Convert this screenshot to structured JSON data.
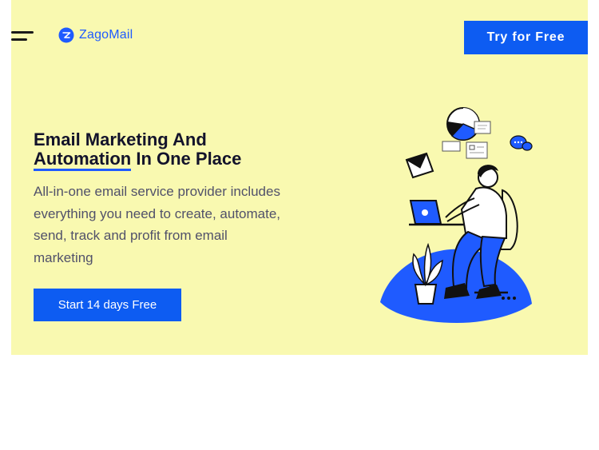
{
  "header": {
    "menu_icon": "hamburger-menu-icon",
    "logo_icon": "zagomail-logo-icon",
    "brand_name": "ZagoMail",
    "cta_label": "Try for Free"
  },
  "hero": {
    "title_part1": "Email Marketing And",
    "title_highlight": "Automation",
    "title_part2": "In One Place",
    "subtitle": "All-in-one email service provider includes everything you need to create, automate, send, track and profit from email marketing",
    "button_label": "Start 14 days Free",
    "illustration": "person-working-on-laptop-illustration"
  },
  "colors": {
    "hero_background": "#f9f9b0",
    "brand_blue": "#0d5cf2",
    "heading_text": "#13132b",
    "body_text": "#51516a"
  }
}
